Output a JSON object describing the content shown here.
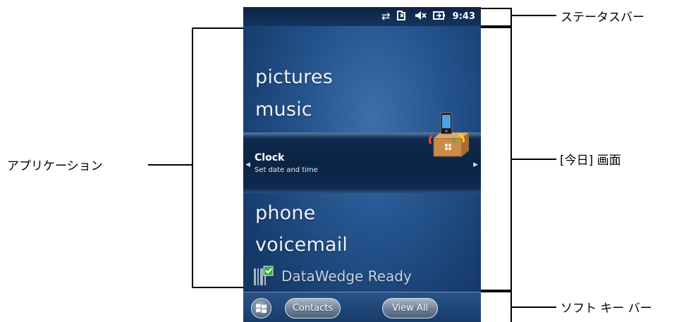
{
  "status_bar": {
    "time": "9:43",
    "icons": [
      "network-sync-icon",
      "signal-icon",
      "speaker-muted-icon",
      "battery-icon"
    ]
  },
  "today": {
    "items": [
      "pictures",
      "music",
      "phone",
      "voicemail"
    ],
    "selected": {
      "title": "Clock",
      "subtitle": "Set date and time",
      "icon": "getting-started-box-icon"
    },
    "datawedge": "DataWedge Ready"
  },
  "softkeys": {
    "start": "windows-start-icon",
    "left": "Contacts",
    "right": "View All"
  },
  "callouts": {
    "status_bar": "ステータスバー",
    "today_screen": "[今日] 画面",
    "soft_key_bar": "ソフト キー バー",
    "applications": "アプリケーション"
  },
  "colors": {
    "screen_bg": "#24538c",
    "status_bg": "#0d2444",
    "text": "#eef3fa"
  }
}
